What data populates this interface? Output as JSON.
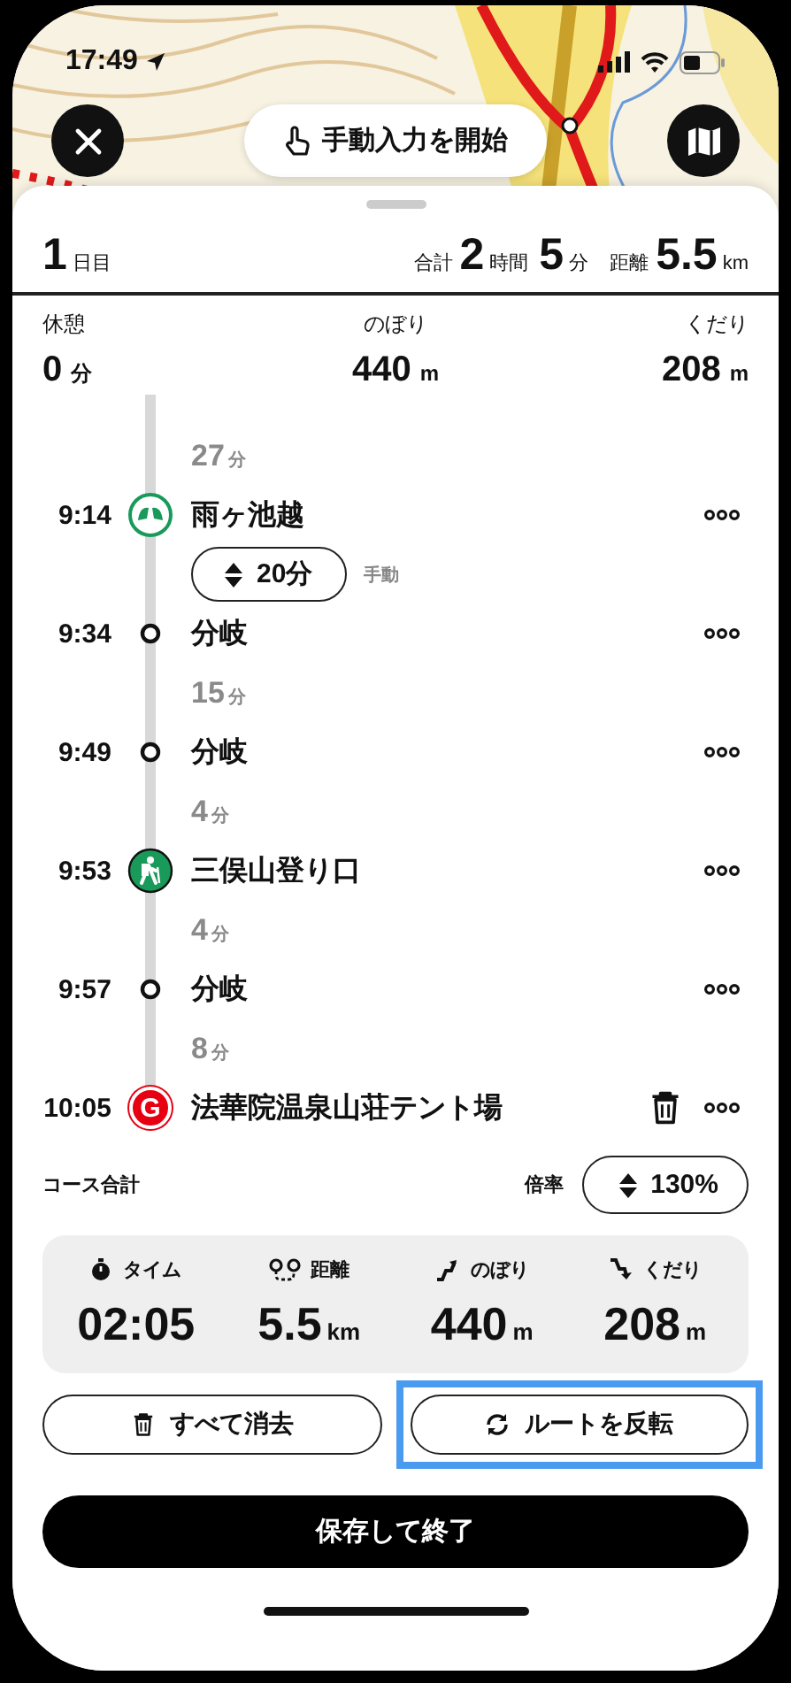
{
  "status_bar": {
    "time": "17:49"
  },
  "map_controls": {
    "manual_button": "手動入力を開始"
  },
  "day_header": {
    "day": "1",
    "day_unit": "日目",
    "total_label": "合計",
    "hours": "2",
    "hours_unit": "時間",
    "minutes": "5",
    "minutes_unit": "分",
    "distance_label": "距離",
    "distance": "5.5",
    "distance_unit": "km"
  },
  "stats": [
    {
      "label": "休憩",
      "value": "0",
      "unit": "分"
    },
    {
      "label": "のぼり",
      "value": "440",
      "unit": "m"
    },
    {
      "label": "くだり",
      "value": "208",
      "unit": "m"
    }
  ],
  "leading_segment": {
    "kind": "duration",
    "value": "27",
    "unit": "分"
  },
  "waypoints": [
    {
      "time": "9:14",
      "name": "雨ヶ池越",
      "kind": "spring",
      "deletable": false,
      "segment": {
        "kind": "rest",
        "value": "20分",
        "note": "手動"
      }
    },
    {
      "time": "9:34",
      "name": "分岐",
      "kind": "branch",
      "deletable": false,
      "segment": {
        "kind": "duration",
        "value": "15",
        "unit": "分"
      }
    },
    {
      "time": "9:49",
      "name": "分岐",
      "kind": "branch",
      "deletable": false,
      "segment": {
        "kind": "duration",
        "value": "4",
        "unit": "分"
      }
    },
    {
      "time": "9:53",
      "name": "三俣山登り口",
      "kind": "trailhead",
      "deletable": false,
      "segment": {
        "kind": "duration",
        "value": "4",
        "unit": "分"
      }
    },
    {
      "time": "9:57",
      "name": "分岐",
      "kind": "branch",
      "deletable": false,
      "segment": {
        "kind": "duration",
        "value": "8",
        "unit": "分"
      }
    },
    {
      "time": "10:05",
      "name": "法華院温泉山荘テント場",
      "kind": "goal",
      "badge": "G",
      "deletable": true
    }
  ],
  "course_total": {
    "label": "コース合計",
    "rate_label": "倍率",
    "rate": "130%"
  },
  "totals": [
    {
      "kind": "time",
      "label": "タイム",
      "value": "02:05"
    },
    {
      "kind": "distance",
      "label": "距離",
      "value": "5.5",
      "unit": "km"
    },
    {
      "kind": "ascent",
      "label": "のぼり",
      "value": "440",
      "unit": "m"
    },
    {
      "kind": "descent",
      "label": "くだり",
      "value": "208",
      "unit": "m"
    }
  ],
  "actions": [
    {
      "kind": "clear",
      "label": "すべて消去",
      "highlighted": false
    },
    {
      "kind": "reverse",
      "label": "ルートを反転",
      "highlighted": true
    }
  ],
  "save_button": "保存して終了"
}
